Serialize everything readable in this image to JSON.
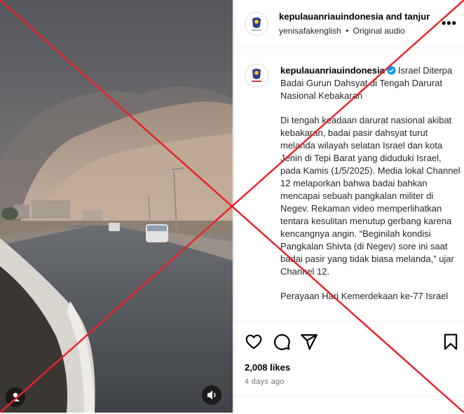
{
  "header": {
    "title": "kepulauanriauindonesia and tanjur",
    "audio_user": "yenisafakenglish",
    "audio_sep": "•",
    "audio_label": "Original audio",
    "more": "•••"
  },
  "caption": {
    "username": "kepulauanriauindonesia",
    "headline_first": "Israel Diterpa",
    "headline_rest": "Badai Gurun Dahsyat di Tengah Darurat Nasional Kebakaran",
    "paragraph1": "Di tengah keadaan darurat nasional akibat kebakaran, badai pasir dahsyat turut melanda wilayah selatan Israel dan kota Jenin di Tepi Barat yang diduduki Israel, pada Kamis (1/5/2025). Media lokal Channel 12 melaporkan bahwa badai bahkan mencapai sebuah pangkalan militer di Negev. Rekaman video memperlihatkan tentara kesulitan menutup gerbang karena kencangnya angin. “Beginilah kondisi Pangkalan Shivta (di Negev) sore ini saat badai pasir yang tidak biasa melanda,” ujar Channel 12.",
    "paragraph2": "Perayaan Hari Kemerdekaan ke-77 Israel"
  },
  "stats": {
    "likes": "2,008 likes",
    "time_ago": "4 days ago"
  },
  "icons": {
    "like": "heart-icon",
    "comment": "comment-icon",
    "share": "share-icon",
    "save": "bookmark-icon",
    "verified": "verified-badge-icon",
    "mute": "speaker-icon",
    "tags": "user-tag-icon"
  },
  "colors": {
    "overlay_cross": "#e8232a",
    "verified": "#0095f6"
  }
}
